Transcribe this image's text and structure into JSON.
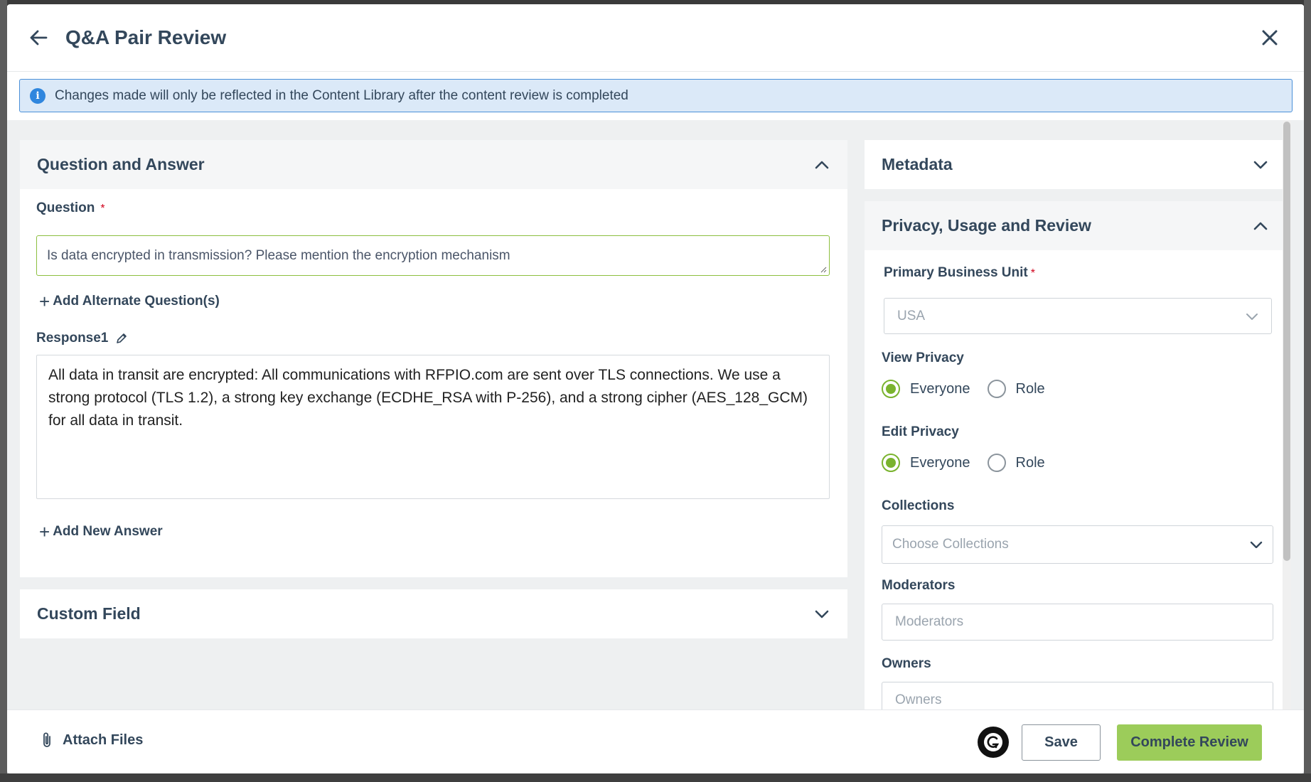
{
  "header": {
    "title": "Q&A Pair Review"
  },
  "banner": {
    "text": "Changes made will only be reflected in the Content Library after the content review is completed"
  },
  "qa_section": {
    "title": "Question and Answer",
    "question_label": "Question",
    "required_mark": "*",
    "question_value": "Is data encrypted in transmission? Please mention the encryption mechanism",
    "add_alternate_label": "Add Alternate Question(s)",
    "response_label": "Response1",
    "response_text": "All data in transit are encrypted: All communications with RFPIO.com are sent over TLS connections. We use a strong protocol (TLS 1.2), a strong key exchange (ECDHE_RSA with P-256), and a strong cipher (AES_128_GCM) for all data in transit.",
    "add_answer_label": "Add New Answer"
  },
  "custom_field": {
    "title": "Custom Field"
  },
  "metadata": {
    "title": "Metadata"
  },
  "privacy": {
    "title": "Privacy, Usage and Review",
    "business_unit_label": "Primary Business Unit",
    "business_unit_value": "USA",
    "view_privacy_label": "View Privacy",
    "edit_privacy_label": "Edit Privacy",
    "option_everyone": "Everyone",
    "option_role": "Role",
    "view_privacy_selected": "Everyone",
    "edit_privacy_selected": "Everyone",
    "collections_label": "Collections",
    "collections_placeholder": "Choose Collections",
    "moderators_label": "Moderators",
    "moderators_placeholder": "Moderators",
    "owners_label": "Owners",
    "owners_placeholder": "Owners"
  },
  "footer": {
    "attach_label": "Attach Files",
    "save_label": "Save",
    "complete_label": "Complete Review"
  },
  "colors": {
    "accent_green": "#9ccc5a",
    "radio_green": "#7ab32e",
    "info_blue": "#2f86de",
    "banner_bg": "#dbe9f8"
  }
}
